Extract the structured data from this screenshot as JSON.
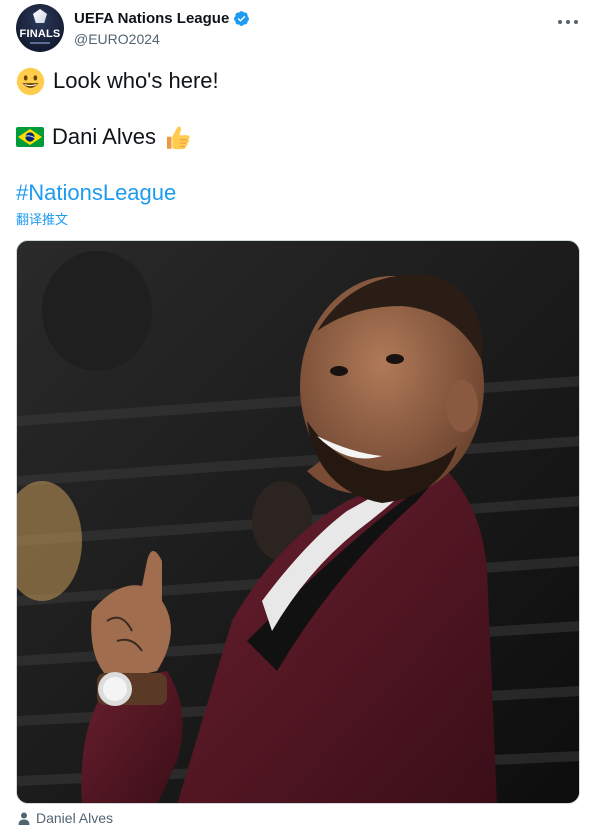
{
  "tweet": {
    "author": {
      "display_name": "UEFA Nations League",
      "handle": "@EURO2024",
      "avatar_text": "FINALS",
      "verified": true
    },
    "lines": {
      "line1": "Look who's here!",
      "line2": "Dani Alves",
      "hashtag": "#NationsLeague"
    },
    "translate_label": "翻译推文",
    "media": {
      "tagged_person": "Daniel Alves"
    }
  },
  "colors": {
    "link": "#1d9bf0",
    "secondary_text": "#536471",
    "verified": "#1d9bf0",
    "jacket": "#4a1420"
  },
  "icons": [
    "verified-badge-icon",
    "more-options-icon",
    "smiling-face-emoji",
    "brazil-flag-emoji",
    "thumbs-up-emoji",
    "person-tag-icon"
  ]
}
